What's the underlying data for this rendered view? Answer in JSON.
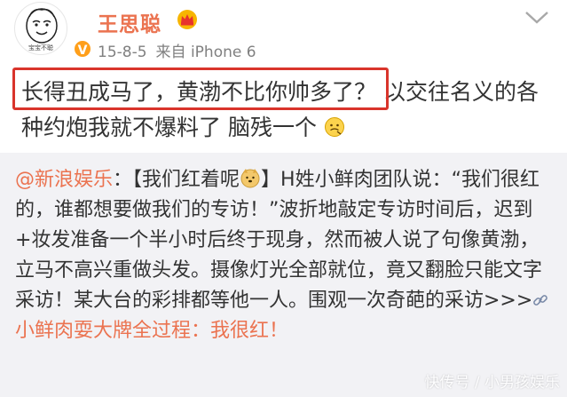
{
  "post": {
    "author": "王思聪",
    "avatar_caption": "宝宝不聪",
    "verified_badge": "V",
    "date": "15-8-5",
    "source": "来自 iPhone 6",
    "text_highlighted": "长得丑成马了，黄渤不比你帅多了？",
    "text_rest": "以交往名义的各种约炮我就不爆料了 脑残一个"
  },
  "repost": {
    "mention": "@新浪娱乐",
    "text_part1": "：【我们红着呢",
    "text_part2": "】H姓小鲜肉团队说：“我们很红的，谁都想要做我们的专访！”波折地敲定专访时间后，迟到+妆发准备一个半小时后终于现身，然而被人说了句像黄渤，立马不高兴重做头发。摄像灯光全部就位，竟又翻脸只能文字采访！某大台的彩排都等他一人。围观一次奇葩的采访>>>",
    "link_text": "小鲜肉耍大牌全过程：我很红！"
  },
  "watermark": "快传号 / 小男孩娱乐",
  "icons": {
    "crown": "crown-icon",
    "chevron": "chevron-down-icon",
    "emoji_face": "emoji-icon",
    "emoji_dog": "doge-icon",
    "link": "link-icon"
  },
  "colors": {
    "username": "#eb7350",
    "highlight_border": "#d9342b",
    "repost_bg": "#f2f2f5",
    "link": "#eb7350"
  }
}
